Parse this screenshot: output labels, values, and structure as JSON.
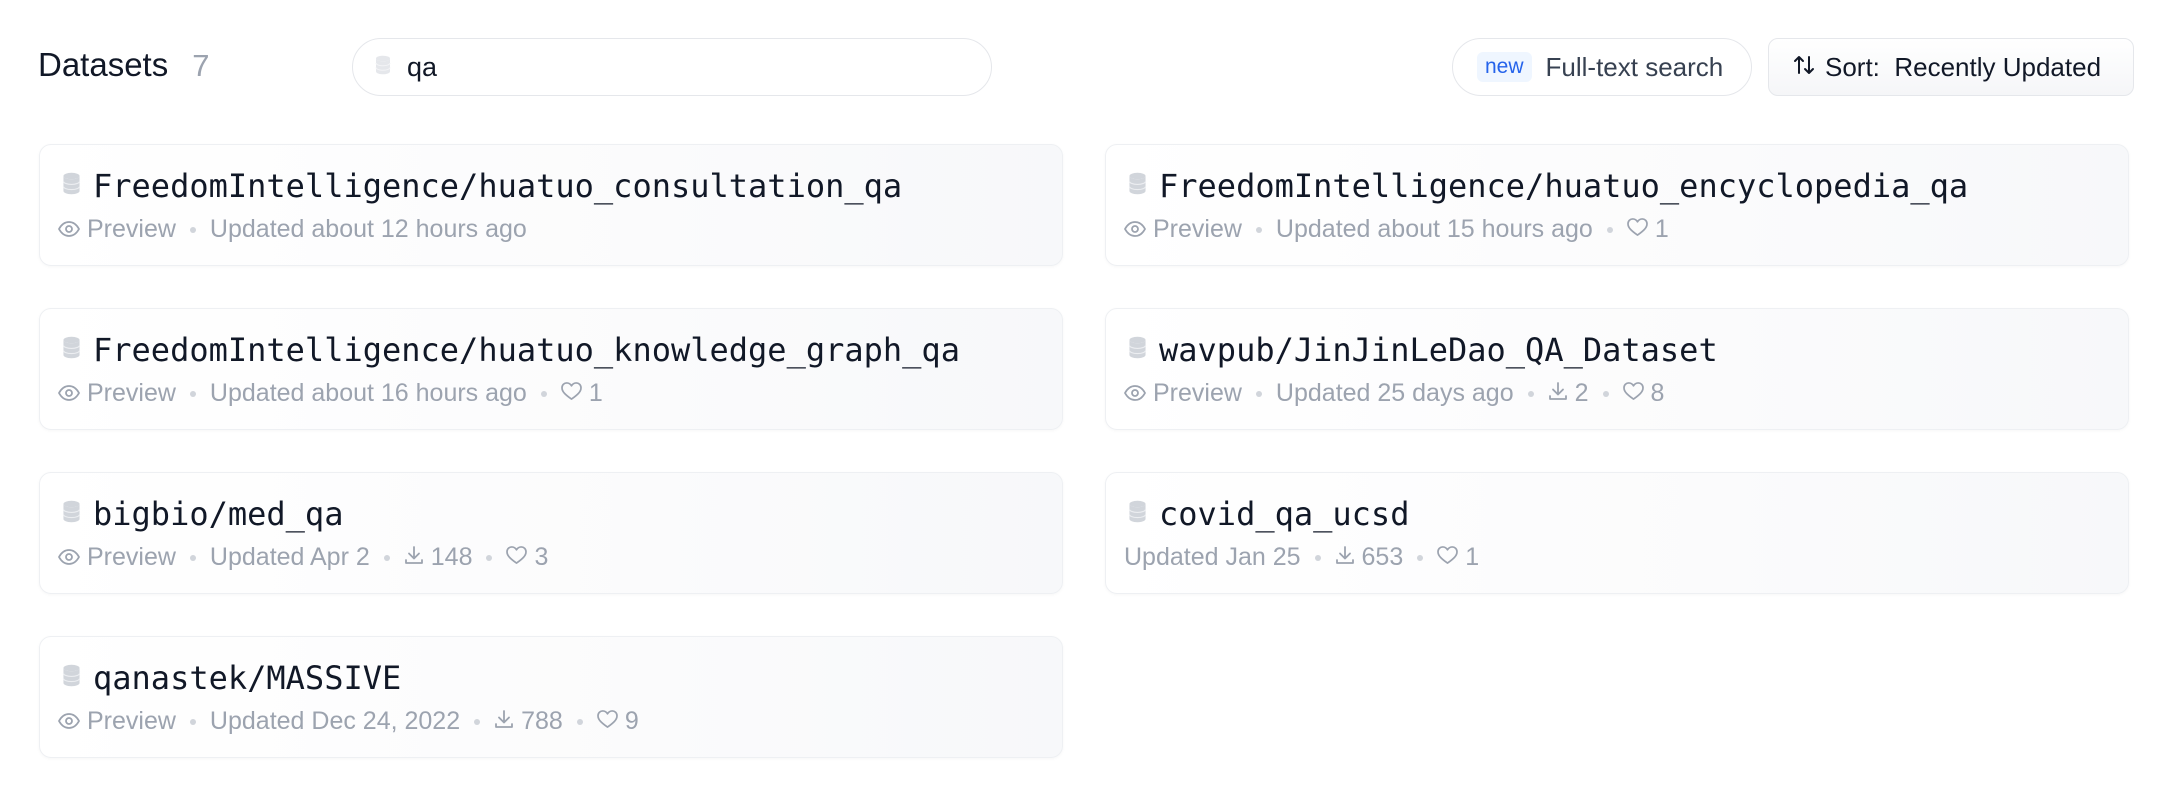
{
  "header": {
    "title": "Datasets",
    "count": "7",
    "search": {
      "value": "qa",
      "icon": "database-icon"
    },
    "fulltext": {
      "badge": "new",
      "label": "Full-text search"
    },
    "sort": {
      "label": "Sort:  Recently Updated",
      "icon": "sort-arrows-icon"
    }
  },
  "datasets": [
    {
      "name": "FreedomIntelligence/huatuo_consultation_qa",
      "preview": "Preview",
      "updated": "Updated about 12 hours ago"
    },
    {
      "name": "FreedomIntelligence/huatuo_encyclopedia_qa",
      "preview": "Preview",
      "updated": "Updated about 15 hours ago",
      "likes": "1"
    },
    {
      "name": "FreedomIntelligence/huatuo_knowledge_graph_qa",
      "preview": "Preview",
      "updated": "Updated about 16 hours ago",
      "likes": "1"
    },
    {
      "name": "wavpub/JinJinLeDao_QA_Dataset",
      "preview": "Preview",
      "updated": "Updated 25 days ago",
      "downloads": "2",
      "likes": "8"
    },
    {
      "name": "bigbio/med_qa",
      "preview": "Preview",
      "updated": "Updated Apr 2",
      "downloads": "148",
      "likes": "3"
    },
    {
      "name": "covid_qa_ucsd",
      "updated": "Updated Jan 25",
      "downloads": "653",
      "likes": "1"
    },
    {
      "name": "qanastek/MASSIVE",
      "preview": "Preview",
      "updated": "Updated Dec 24, 2022",
      "downloads": "788",
      "likes": "9"
    }
  ]
}
